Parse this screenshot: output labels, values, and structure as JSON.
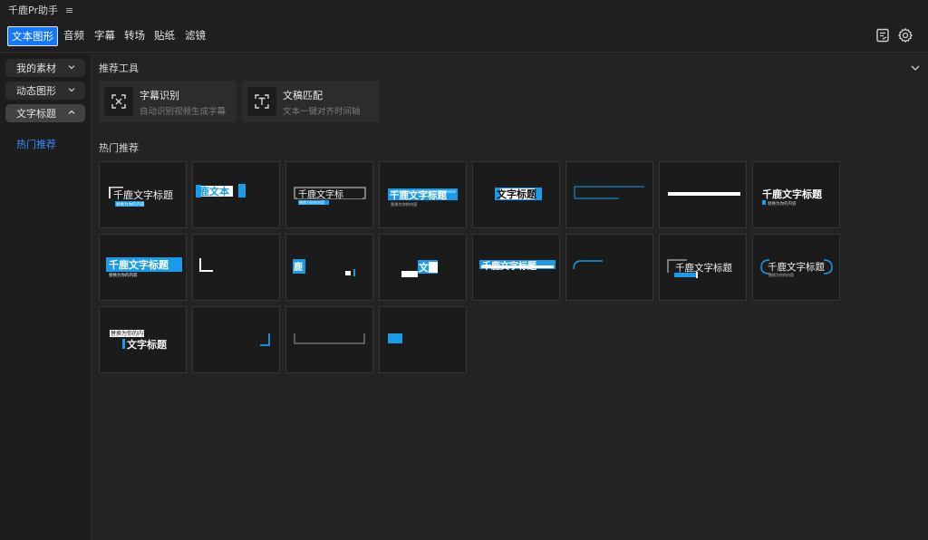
{
  "app": {
    "title": "千鹿Pr助手"
  },
  "tabs": [
    "文本图形",
    "音频",
    "字幕",
    "转场",
    "贴纸",
    "滤镜"
  ],
  "sidebar": {
    "items": [
      {
        "label": "我的素材"
      },
      {
        "label": "动态图形"
      },
      {
        "label": "文字标题"
      }
    ],
    "sub_items": [
      "热门推荐"
    ]
  },
  "main": {
    "tools_heading": "推荐工具",
    "tools": [
      {
        "title": "字幕识别",
        "desc": "自动识别视频生成字幕"
      },
      {
        "title": "文稿匹配",
        "desc": "文本一键对齐时间轴"
      }
    ],
    "hot_heading": "热门推荐"
  },
  "thumbs": [
    {
      "text": "千鹿文字标题",
      "sub": "替换为你的内容"
    },
    {
      "text": "鹿文本"
    },
    {
      "text": "千鹿文字标",
      "sub": "替换为你的内容"
    },
    {
      "text": "千鹿文字标题",
      "sub": "替换为你的内容"
    },
    {
      "text": "文字标题"
    },
    {
      "text": ""
    },
    {
      "text": ""
    },
    {
      "text": "千鹿文字标题",
      "sub": "替换为你的内容"
    },
    {
      "text": "千鹿文字标题",
      "sub": "替换为你的内容"
    },
    {
      "text": ""
    },
    {
      "text": "鹿"
    },
    {
      "text": "文"
    },
    {
      "text": "千鹿文字标题"
    },
    {
      "text": ""
    },
    {
      "text": "千鹿文字标题"
    },
    {
      "text": "千鹿文字标题",
      "sub": "替换为你的内容"
    },
    {
      "text": "文字标题",
      "sub": "替换为你的内容"
    },
    {
      "text": ""
    },
    {
      "text": ""
    },
    {
      "text": ""
    }
  ],
  "colors": {
    "accent": "#1677ff",
    "highlight": "#1a9bea",
    "link": "#3d8bff"
  },
  "icons": {
    "menu": "hamburger-icon",
    "top_right": [
      "notes-icon",
      "settings-gear-icon"
    ],
    "tools": [
      "scan-subtitle-icon",
      "text-match-icon"
    ]
  }
}
